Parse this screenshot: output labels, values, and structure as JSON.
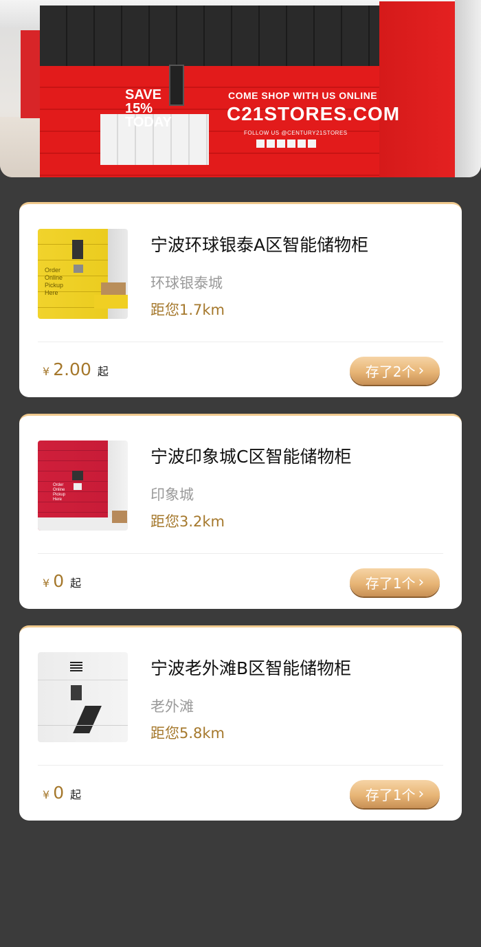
{
  "hero": {
    "promo": "SAVE 15% TODAY",
    "tagline": "COME SHOP WITH US ONLINE",
    "domain": "C21STORES.COM",
    "follow": "FOLLOW US @CENTURY21STORES"
  },
  "lockers": [
    {
      "title": "宁波环球银泰A区智能储物柜",
      "mall": "环球银泰城",
      "distance": "距您1.7km",
      "currency": "¥",
      "price": "2.00",
      "price_suffix": "起",
      "stored": "存了2个",
      "thumb_text": "Order Online Pickup Here",
      "thumb_icon": "yellow-locker-image"
    },
    {
      "title": "宁波印象城C区智能储物柜",
      "mall": "印象城",
      "distance": "距您3.2km",
      "currency": "¥",
      "price": "0",
      "price_suffix": "起",
      "stored": "存了1个",
      "thumb_text": "Order Online Pickup Here",
      "thumb_icon": "red-locker-image"
    },
    {
      "title": "宁波老外滩B区智能储物柜",
      "mall": "老外滩",
      "distance": "距您5.8km",
      "currency": "¥",
      "price": "0",
      "price_suffix": "起",
      "stored": "存了1个",
      "thumb_icon": "white-locker-image"
    }
  ],
  "chevron": "›",
  "colors": {
    "background": "#3b3b3b",
    "accent_gold": "#a5782c",
    "button_gradient_top": "#f6d4a5",
    "button_gradient_bottom": "#c89055",
    "card_top_border": "#f0c98d"
  }
}
